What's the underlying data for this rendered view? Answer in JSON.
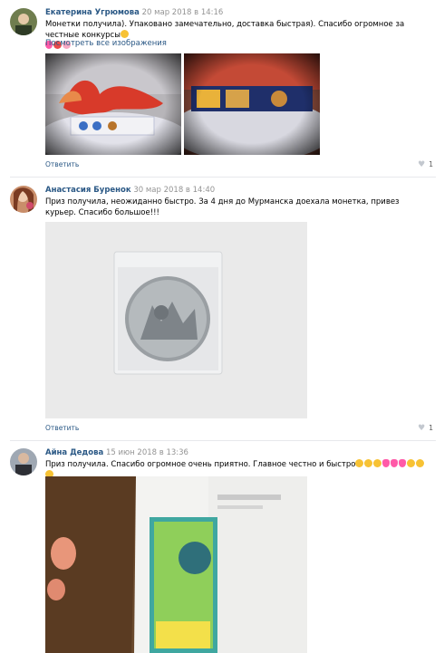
{
  "comments": [
    {
      "author": "Екатерина Угрюмова",
      "date": "20 мар 2018 в 14:16",
      "text": "Монетки получила). Упаковано замечательно, доставка быстрая). Спасибо огромное за честные конкурсы",
      "link": "Посмотреть все изображения",
      "reply": "Ответить",
      "likes": "1"
    },
    {
      "author": "Анастасия Буренок",
      "date": "30 мар 2018 в 14:40",
      "text": "Приз получила, неожиданно быстро. За 4 дня до Мурманска доехала монетка, привез курьер. Спасибо большое!!!",
      "reply": "Ответить",
      "likes": "1"
    },
    {
      "author": "Айна Дедова",
      "date": "15 июн 2018 в 13:36",
      "text": "Приз получила. Спасибо огромное очень приятно. Главное честно и быстро"
    }
  ],
  "icons": {
    "like": "heart-icon"
  },
  "colors": {
    "link": "#2a5885",
    "date": "#939393",
    "divider": "#e7e8ec"
  }
}
